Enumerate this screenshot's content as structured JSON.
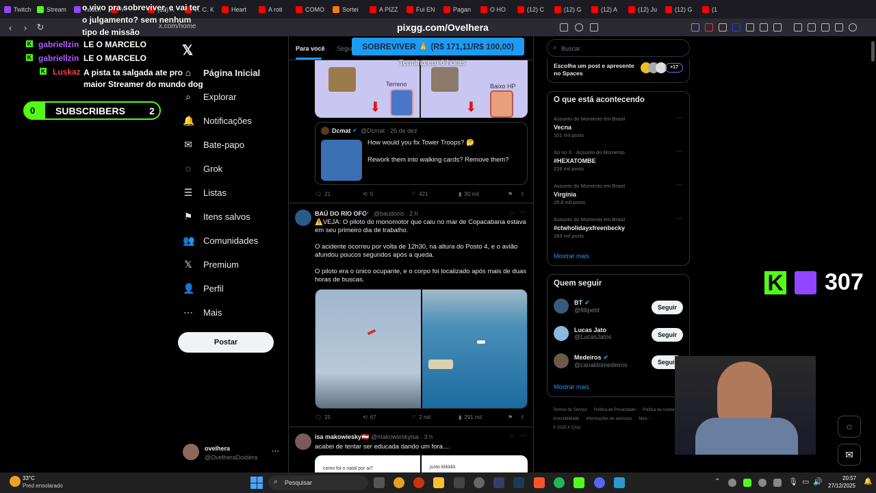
{
  "browser": {
    "tabs": [
      {
        "label": "Twitch",
        "color": "#9146ff"
      },
      {
        "label": "Stream",
        "color": "#53fc18"
      },
      {
        "label": "Twitch",
        "color": "#9146ff"
      },
      {
        "label": "Y",
        "color": "#ff0000"
      },
      {
        "label": "(12) A",
        "color": "#ff0000"
      },
      {
        "label": "И. С. К",
        "color": "#ff0000"
      },
      {
        "label": "Heart",
        "color": "#ff0000"
      },
      {
        "label": "A roti",
        "color": "#ff0000"
      },
      {
        "label": "COMO",
        "color": "#ff0000"
      },
      {
        "label": "Sortei",
        "color": "#ff7a00"
      },
      {
        "label": "A PIZZ",
        "color": "#ff0000"
      },
      {
        "label": "Fui EN",
        "color": "#ff0000"
      },
      {
        "label": "Pagan",
        "color": "#ff0000"
      },
      {
        "label": "O HO",
        "color": "#ff0000"
      },
      {
        "label": "(12) C",
        "color": "#ff0000"
      },
      {
        "label": "(12) G",
        "color": "#ff0000"
      },
      {
        "label": "(12) A",
        "color": "#ff0000"
      },
      {
        "label": "(12) Ju",
        "color": "#ff0000"
      },
      {
        "label": "(12) G",
        "color": "#ff0000"
      },
      {
        "label": "(1",
        "color": "#ff0000"
      }
    ],
    "url": "x.com/home",
    "page_title": "pixgg.com/Ovelhera"
  },
  "overlay": {
    "chat": [
      {
        "user": "gabriellzin",
        "msg": "LE O MARCELO",
        "color": "#b05cff",
        "badge": "#53fc18"
      },
      {
        "user": "gabriellzin",
        "msg": "LE O MARCELO",
        "color": "#b05cff",
        "badge": "#53fc18"
      },
      {
        "user": "Luskaz",
        "msg": "A pista ta salgada ate pro maior Streamer do mundo dog",
        "color": "#ff3b3b",
        "badge": "#53fc18"
      }
    ],
    "top_message": "o vivo pra sobreviver, e vai ter o julgamento? sem nenhum tipo de missão",
    "subs_count": "0",
    "subs_label": "SUBSCRIBERS",
    "subs_goal": "2",
    "goal_label": "SOBREVIVER 🙏 (R$ 171,11/R$ 100,00)",
    "goal_sub": "Termina em 6 horas",
    "viewers": "307"
  },
  "sidebar": {
    "items": [
      {
        "label": "Página Inicial",
        "icon": "home-icon",
        "glyph": "⌂"
      },
      {
        "label": "Explorar",
        "icon": "search-icon",
        "glyph": "⌕"
      },
      {
        "label": "Notificações",
        "icon": "bell-icon",
        "glyph": "🔔"
      },
      {
        "label": "Bate-papo",
        "icon": "mail-icon",
        "glyph": "✉"
      },
      {
        "label": "Grok",
        "icon": "grok-icon",
        "glyph": "◌"
      },
      {
        "label": "Listas",
        "icon": "list-icon",
        "glyph": "☰"
      },
      {
        "label": "Itens salvos",
        "icon": "bookmark-icon",
        "glyph": "⚑"
      },
      {
        "label": "Comunidades",
        "icon": "communities-icon",
        "glyph": "👥"
      },
      {
        "label": "Premium",
        "icon": "x-logo-icon",
        "glyph": "𝕏"
      },
      {
        "label": "Perfil",
        "icon": "profile-icon",
        "glyph": "👤"
      },
      {
        "label": "Mais",
        "icon": "more-icon",
        "glyph": "⋯"
      }
    ],
    "post_label": "Postar",
    "account_name": "ovelhera",
    "account_handle": "@OvelheraDoidera"
  },
  "feed": {
    "tab_for_you": "Para você",
    "tab_following": "Seguindo",
    "card_labels": {
      "left": "Terreno",
      "right": "Baixo HP"
    },
    "quote": {
      "name": "Dcmat",
      "handle": "@Dcmat · 26 de dez",
      "line1": "How would you fix Tower Troops? 🤔",
      "line2": "Rework them into walking cards? Remove them?"
    },
    "actions1": {
      "replies": "21",
      "retweets": "5",
      "likes": "421",
      "views": "30 mil"
    },
    "tweet2": {
      "name": "BAÚ DO RIO OFC",
      "handle": "@baudorio · 2 h",
      "p1": "⚠️VEJA: O piloto do monomotor que caiu no mar de Copacabana estava em seu primeiro dia de trabalho.",
      "p2": "O acidente ocorreu por volta de 12h30, na altura do Posto 4, e o avião afundou poucos segundos após a queda.",
      "p3": "O piloto era o único ocupante, e o corpo foi localizado após mais de duas horas de buscas."
    },
    "actions2": {
      "replies": "25",
      "retweets": "67",
      "likes": "2 mil",
      "views": "291 mil"
    },
    "tweet3": {
      "name": "isa makowiesky🇦🇹",
      "handle": "@makowieskyisa · 3 h",
      "text": "acabei de tentar ser educada dando um fora....",
      "img_left": "como foi o natal por ai?",
      "img_right": "justo kkkkkk"
    }
  },
  "right": {
    "search_placeholder": "Buscar",
    "spaces_text": "Escolha um post e apresente no Spaces",
    "spaces_count": "+17",
    "trending_title": "O que está acontecendo",
    "trends": [
      {
        "context": "Assunto do Momento em Brasil",
        "name": "Vecna",
        "posts": "101 mil posts"
      },
      {
        "context": "Só no X · Assunto do Momento",
        "name": "#HEXATOMBE",
        "posts": "228 mil posts"
      },
      {
        "context": "Assunto do Momento em Brasil",
        "name": "Virgínia",
        "posts": "28,8 mil posts"
      },
      {
        "context": "Assunto do Momento em Brasil",
        "name": "#ctwholidayxfreenbecky",
        "posts": "283 mil posts"
      }
    ],
    "show_more": "Mostrar mais",
    "who_title": "Quem seguir",
    "who": [
      {
        "name": "BT",
        "handle": "@fillipebt",
        "verified": true
      },
      {
        "name": "Lucas Jato",
        "handle": "@LucasJatos",
        "verified": false
      },
      {
        "name": "Medeiros",
        "handle": "@canaldomedeiros",
        "verified": true
      }
    ],
    "follow_label": "Seguir",
    "footer": [
      "Termos de Serviço",
      "Política de Privacidade",
      "Política de cookies",
      "Acessibilidade",
      "Informações de anúncios",
      "Mais ···",
      "© 2025 X Corp."
    ]
  },
  "taskbar": {
    "temp": "33°C",
    "weather": "Pred ensolarado",
    "search": "Pesquisar",
    "time": "20:57",
    "date": "27/12/2025"
  },
  "colors": {
    "x_blue": "#1d9bf0",
    "kick_green": "#53fc18",
    "twitch_purple": "#9146ff"
  }
}
